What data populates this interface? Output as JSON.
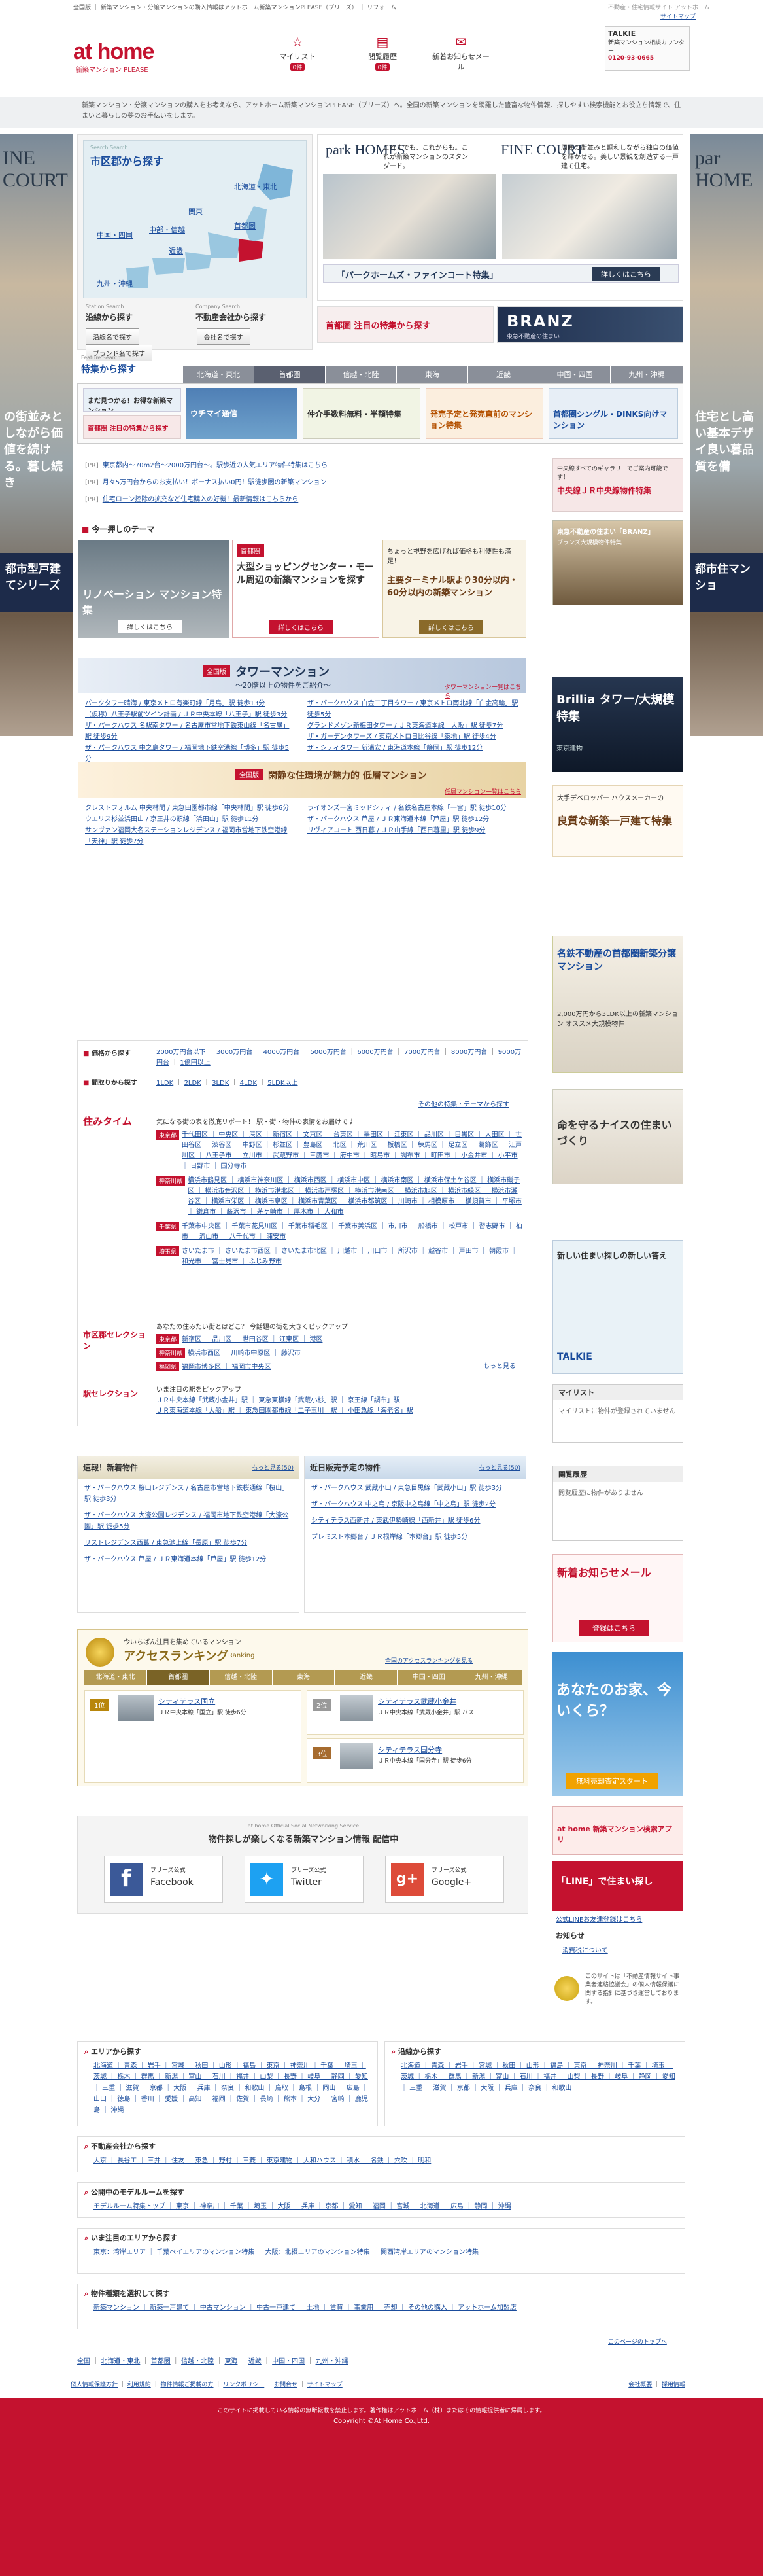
{
  "header": {
    "top_links": "全国版 ｜ 新築マンション・分譲マンションの購入情報はアットホーム新築マンションPLEASE（プリーズ） ｜ リフォーム",
    "right_links": "不動産・住宅情報サイト アットホーム",
    "site_map": "サイトマップ",
    "logo": "at home",
    "logo_sub": "新築マンション PLEASE",
    "mylist_label": "マイリスト",
    "mylist_count": "0件",
    "history_label": "閲覧履歴",
    "history_count": "0件",
    "mail_label": "新着お知らせメール",
    "talkie_title": "TALKIE",
    "talkie_text": "新築マンション相談カウンター",
    "talkie_phone": "0120-93-0665"
  },
  "intro": "新築マンション・分譲マンションの購入をお考えなら、アットホーム新築マンションPLEASE（プリーズ）へ。全国の新築マンションを網羅した豊富な物件情報、探しやすい検索機能とお役立ち情報で、住まいと暮らしの夢のお手伝いをします。",
  "side_left": {
    "title": "INE COURT",
    "text": "の街並みとしながら価値を続ける。暮し続き",
    "band": "都市型戸建てシリーズ"
  },
  "side_right": {
    "title": "par HOME",
    "text": "住宅とし高い基本デザイ良い暮品質を備",
    "band": "都市住マンショ"
  },
  "search": {
    "map_label": "Search Search",
    "map_title": "市区郡から探す",
    "regions": [
      "北海道・東北",
      "関東",
      "中部・信越",
      "近畿",
      "中国・四国",
      "九州・沖縄",
      "首都圏"
    ],
    "station_label": "Station Search",
    "station_title": "沿線から探す",
    "company_label": "Company Search",
    "company_title": "不動産会社から探す",
    "btn_station": "沿線名で探す",
    "btn_company": "会社名で探す",
    "btn_brand": "ブランド名で探す",
    "feature_label": "Feature Search",
    "feature_title": "特集から探す"
  },
  "promo_main": {
    "park_title": "park HOMES",
    "fine_title": "FINE COURT",
    "park_text": "これまでも、これからも。これが新築マンションのスタンダード。",
    "fine_text": "周囲の街並みと調和しながら独自の価値を輝かせる。美しい景観を創造する一戸建て住宅。",
    "banner": "「パークホームズ・ファインコート特集」",
    "banner_btn": "詳しくはこちら",
    "branz": "BRANZ",
    "branz_sub": "東急不動産の住まい",
    "fine_banner": "首都圏 注目の特集から探す"
  },
  "region_tabs": [
    "北海道・東北",
    "首都圏",
    "信越・北陸",
    "東海",
    "近畿",
    "中国・四国",
    "九州・沖縄"
  ],
  "feature_banners": [
    "まだ見つかる！お得な新築マンション",
    "首都圏 注目の特集から探す",
    "ウチマイ通信",
    "仲介手数料無料・半額特集",
    "駅近物件特集",
    "発売予定と発売直前のマンション特集",
    "首都圏シングル・DINKS向けマンション"
  ],
  "news": [
    "東京都内〜70m2台〜2000万円台〜。駅歩近の人気エリア物件特集はこちら",
    "月々5万円台からのお支払い！ボーナス払い0円！駅徒歩圏の新築マンション",
    "住宅ローン控除の拡充など住宅購入の好機！最新情報はこちらから"
  ],
  "right_ads": [
    {
      "title": "中央線ＪＲ中央線物件特集",
      "sub": "中央線すべてのギャラリーでご案内可能です！"
    },
    {
      "title": "東急不動産の住まい「BRANZ」",
      "sub": "ブランズ大規模物件特集"
    },
    {
      "title": "Brillia タワー/大規模特集",
      "sub": "東京建物"
    },
    {
      "title": "名鉄不動産の首都圏新築分譲マンション",
      "sub": "2,000万円から3LDK以上の新築マンション オススメ大規模物件"
    },
    {
      "title": "良質な新築一戸建て特集",
      "sub": "大手デベロッパー ハウスメーカーの"
    },
    {
      "title": "命を守るナイスの住まいづくり",
      "sub": ""
    },
    {
      "title": "新しい住まい探しの新しい答え",
      "sub": "TALKIE"
    }
  ],
  "mylist_box": {
    "title": "マイリスト",
    "text": "マイリストに物件が登録されていません"
  },
  "history_box": {
    "title": "閲覧履歴",
    "text": "閲覧履歴に物件がありません"
  },
  "right_bottom": {
    "mail_title": "新着お知らせメール",
    "mail_btn": "登録はこちら",
    "price_title": "あなたのお家、今いくら？",
    "price_btn": "無料売却査定スタート",
    "app_title": "at home 新築マンション検索アプリ",
    "line_title": "「LINE」で住まい探し",
    "line_link": "公式LINEお友達登録はこちら",
    "notice_title": "お知らせ",
    "notice_link": "消費税について",
    "privacy_text": "このサイトは「不動産情報サイト事業者連絡協議会」の個人情報保護に関する指針に基づき運営しております。"
  },
  "theme": {
    "heading": "今一押しのテーマ",
    "renovation": "リノベーション マンション特集",
    "renovation_btn": "詳しくはこちら",
    "shopping_tag": "首都圏",
    "shopping": "大型ショッピングセンター・モール周辺の新築マンションを探す",
    "shopping_btn": "詳しくはこちら",
    "terminal": "主要ターミナル駅より30分以内・60分以内の新築マンション",
    "terminal_note": "ちょっと視野を広げれば価格も利便性も満足！",
    "terminal_btn": "詳しくはこちら"
  },
  "tower": {
    "tag": "全国版",
    "title": "タワーマンション",
    "sub": "〜20階以上の物件をご紹介〜",
    "more": "タワーマンション一覧はこちら",
    "items": [
      "パークタワー晴海 / 東京メトロ有楽町線「月島」駅 徒歩13分",
      "ザ・パークハウス 白金二丁目タワー / 東京メトロ南北線「白金高輪」駅 徒歩5分",
      "（仮称）八王子駅前ツイン計画 / ＪＲ中央本線「八王子」駅 徒歩3分",
      "グランドメゾン新梅田タワー / ＪＲ東海道本線「大阪」駅 徒歩7分",
      "ザ・パークハウス 名駅南タワー / 名古屋市営地下鉄東山線「名古屋」駅 徒歩9分",
      "ザ・ガーデンタワーズ / 東京メトロ日比谷線「築地」駅 徒歩4分",
      "ザ・パークハウス 中之島タワー / 福岡地下鉄空港線「博多」駅 徒歩5分",
      "ザ・シティタワー 新浦安 / 東海道本線「静岡」駅 徒歩12分"
    ]
  },
  "lowrise": {
    "tag": "全国版",
    "title": "閑静な住環境が魅力的 低層マンション",
    "more": "低層マンション一覧はこちら",
    "items": [
      "クレストフォルム 中央林間 / 東急田園都市線「中央林間」駅 徒歩6分",
      "ライオンズ一宮ミッドシティ / 名鉄名古屋本線「一宮」駅 徒歩10分",
      "ウエリス杉並浜田山 / 京王井の頭線「浜田山」駅 徒歩11分",
      "ザ・パークハウス 芦屋 / ＪＲ東海道本線「芦屋」駅 徒歩12分",
      "サンヴァン福岡大名ステーションレジデンス / 福岡市営地下鉄空港線「天神」駅 徒歩7分",
      "リヴィアコート 西日暮 / ＪＲ山手線「西日暮里」駅 徒歩9分"
    ]
  },
  "price_search": {
    "label": "価格から探す",
    "tag": "首都圏",
    "items": [
      "2000万円台以下",
      "3000万円台",
      "4000万円台",
      "5000万円台",
      "6000万円台",
      "7000万円台",
      "8000万円台",
      "9000万円台",
      "1億円以上"
    ]
  },
  "layout_search": {
    "label": "間取りから探す",
    "items": [
      "1LDK",
      "2LDK",
      "3LDK",
      "4LDK",
      "5LDK以上"
    ],
    "more": "その他の特集・テーマから探す"
  },
  "sumi_time": {
    "logo": "住みタイム",
    "intro": "気になる街の表を徹底リポート！ 駅・街・物件の表情をお届けです",
    "rows": [
      {
        "area": "東京都",
        "text": "千代田区 ｜ 中央区 ｜ 港区 ｜ 新宿区 ｜ 文京区 ｜ 台東区 ｜ 墨田区 ｜ 江東区 ｜ 品川区 ｜ 目黒区 ｜ 大田区 ｜ 世田谷区 ｜ 渋谷区 ｜ 中野区 ｜ 杉並区 ｜ 豊島区 ｜ 北区 ｜ 荒川区 ｜ 板橋区 ｜ 練馬区 ｜ 足立区 ｜ 葛飾区 ｜ 江戸川区 ｜ 八王子市 ｜ 立川市 ｜ 武蔵野市 ｜ 三鷹市 ｜ 府中市 ｜ 昭島市 ｜ 調布市 ｜ 町田市 ｜ 小金井市 ｜ 小平市 ｜ 日野市 ｜ 国分寺市"
      },
      {
        "area": "神奈川県",
        "text": "横浜市鶴見区 ｜ 横浜市神奈川区 ｜ 横浜市西区 ｜ 横浜市中区 ｜ 横浜市南区 ｜ 横浜市保土ケ谷区 ｜ 横浜市磯子区 ｜ 横浜市金沢区 ｜ 横浜市港北区 ｜ 横浜市戸塚区 ｜ 横浜市港南区 ｜ 横浜市旭区 ｜ 横浜市緑区 ｜ 横浜市瀬谷区 ｜ 横浜市栄区 ｜ 横浜市泉区 ｜ 横浜市青葉区 ｜ 横浜市都筑区 ｜ 川崎市 ｜ 相模原市 ｜ 横須賀市 ｜ 平塚市 ｜ 鎌倉市 ｜ 藤沢市 ｜ 茅ヶ崎市 ｜ 厚木市 ｜ 大和市"
      },
      {
        "area": "千葉県",
        "text": "千葉市中央区 ｜ 千葉市花見川区 ｜ 千葉市稲毛区 ｜ 千葉市美浜区 ｜ 市川市 ｜ 船橋市 ｜ 松戸市 ｜ 習志野市 ｜ 柏市 ｜ 流山市 ｜ 八千代市 ｜ 浦安市"
      },
      {
        "area": "埼玉県",
        "text": "さいたま市 ｜ さいたま市西区 ｜ さいたま市北区 ｜ 川越市 ｜ 川口市 ｜ 所沢市 ｜ 越谷市 ｜ 戸田市 ｜ 朝霞市 ｜ 和光市 ｜ 富士見市 ｜ ふじみ野市"
      }
    ]
  },
  "shikugun": {
    "logo": "市区郡セレクション",
    "intro": "あなたの住みたい街とはどこ？ 今話題の街を大きくピックアップ",
    "rows": [
      {
        "area": "東京都",
        "text": "新宿区 ｜ 品川区 ｜ 世田谷区 ｜ 江東区 ｜ 港区"
      },
      {
        "area": "神奈川県",
        "text": "横浜市西区 ｜ 川崎市中原区 ｜ 藤沢市"
      },
      {
        "area": "福岡県",
        "text": "福岡市博多区 ｜ 福岡市中央区"
      }
    ],
    "more": "もっと見る"
  },
  "eki": {
    "logo": "駅セレクション",
    "intro": "いま注目の駅をピックアップ",
    "rows": [
      "ＪＲ中央本線「武蔵小金井」駅 ｜ 東急東横線「武蔵小杉」駅 ｜ 京王線「調布」駅",
      "ＪＲ東海道本線「大船」駅 ｜ 東急田園都市線「二子玉川」駅 ｜ 小田急線「海老名」駅"
    ]
  },
  "new_arrivals": {
    "title": "速報！新着物件",
    "more": "もっと見る(50)",
    "items": [
      "ザ・パークハウス 桜山レジデンス / 名古屋市営地下鉄桜通線「桜山」駅 徒歩3分",
      "ザ・パークハウス 大濠公園レジデンス / 福岡市地下鉄空港線「大濠公園」駅 徒歩5分",
      "リストレジデンス西葛 / 東急池上線「長原」駅 徒歩7分",
      "ザ・パークハウス 芦屋 / ＪＲ東海道本線「芦屋」駅 徒歩12分"
    ]
  },
  "upcoming": {
    "title": "近日販売予定の物件",
    "more": "もっと見る(50)",
    "items": [
      "ザ・パークハウス 武蔵小山 / 東急目黒線「武蔵小山」駅 徒歩3分",
      "ザ・パークハウス 中之島 / 京阪中之島線「中之島」駅 徒歩2分",
      "シティテラス西新井 / 東武伊勢崎線「西新井」駅 徒歩6分",
      "プレミスト本郷台 / ＪＲ根岸線「本郷台」駅 徒歩5分"
    ]
  },
  "ranking": {
    "intro": "今いちばん注目を集めているマンション",
    "title": "アクセスランキング",
    "sub": "Ranking",
    "tabs": [
      "北海道・東北",
      "首都圏",
      "信越・北陸",
      "東海",
      "近畿",
      "中国・四国",
      "九州・沖縄"
    ],
    "link": "全国のアクセスランキングを見る",
    "first": {
      "rank": "1位",
      "name": "シティテラス国立",
      "station": "ＪＲ中央本線「国立」駅 徒歩6分"
    },
    "second": {
      "rank": "2位",
      "name": "シティテラス武蔵小金井",
      "station": "ＪＲ中央本線「武蔵小金井」駅 バス"
    },
    "third": {
      "rank": "3位",
      "name": "シティテラス国分寺",
      "station": "ＪＲ中央本線「国分寺」駅 徒歩6分"
    }
  },
  "social": {
    "eng": "at home Official Social Networking Service",
    "title": "物件探しが楽しくなる新築マンション情報 配信中",
    "facebook": "Facebook",
    "twitter": "Twitter",
    "google": "Google+",
    "sub": "ブリーズ公式"
  },
  "footer_sections": [
    {
      "title": "エリアから探す",
      "body": "北海道 ｜ 青森 ｜ 岩手 ｜ 宮城 ｜ 秋田 ｜ 山形 ｜ 福島 ｜ 東京 ｜ 神奈川 ｜ 千葉 ｜ 埼玉 ｜ 茨城 ｜ 栃木 ｜ 群馬 ｜ 新潟 ｜ 富山 ｜ 石川 ｜ 福井 ｜ 山梨 ｜ 長野 ｜ 岐阜 ｜ 静岡 ｜ 愛知 ｜ 三重 ｜ 滋賀 ｜ 京都 ｜ 大阪 ｜ 兵庫 ｜ 奈良 ｜ 和歌山 ｜ 鳥取 ｜ 島根 ｜ 岡山 ｜ 広島 ｜ 山口 ｜ 徳島 ｜ 香川 ｜ 愛媛 ｜ 高知 ｜ 福岡 ｜ 佐賀 ｜ 長崎 ｜ 熊本 ｜ 大分 ｜ 宮崎 ｜ 鹿児島 ｜ 沖縄"
    },
    {
      "title": "沿線から探す",
      "body": "北海道 ｜ 青森 ｜ 岩手 ｜ 宮城 ｜ 秋田 ｜ 山形 ｜ 福島 ｜ 東京 ｜ 神奈川 ｜ 千葉 ｜ 埼玉 ｜ 茨城 ｜ 栃木 ｜ 群馬 ｜ 新潟 ｜ 富山 ｜ 石川 ｜ 福井 ｜ 山梨 ｜ 長野 ｜ 岐阜 ｜ 静岡 ｜ 愛知 ｜ 三重 ｜ 滋賀 ｜ 京都 ｜ 大阪 ｜ 兵庫 ｜ 奈良 ｜ 和歌山"
    },
    {
      "title": "不動産会社から探す",
      "body": "大京 ｜ 長谷工 ｜ 三井 ｜ 住友 ｜ 東急 ｜ 野村 ｜ 三菱 ｜ 東京建物 ｜ 大和ハウス ｜ 積水 ｜ 名鉄 ｜ 穴吹 ｜ 明和"
    },
    {
      "title": "公開中のモデルルームを探す",
      "body": "モデルルーム特集トップ ｜ 東京 ｜ 神奈川 ｜ 千葉 ｜ 埼玉 ｜ 大阪 ｜ 兵庫 ｜ 京都 ｜ 愛知 ｜ 福岡 ｜ 宮城 ｜ 北海道 ｜ 広島 ｜ 静岡 ｜ 沖縄"
    },
    {
      "title": "いま注目のエリアから探す",
      "body": "東京：湾岸エリア ｜ 千葉ベイエリアのマンション特集 ｜ 大阪：北摂エリアのマンション特集 ｜ 関西湾岸エリアのマンション特集"
    },
    {
      "title": "物件種類を選択して探す",
      "body": "新築マンション ｜ 新築一戸建て ｜ 中古マンション ｜ 中古一戸建て ｜ 土地 ｜ 賃貸 ｜ 事業用 ｜ 売却 ｜ その他の購入 ｜ アットホーム加盟店"
    }
  ],
  "page_top": "このページのトップへ",
  "region_footer": [
    "全国",
    "北海道・東北",
    "首都圏",
    "信越・北陸",
    "東海",
    "近畿",
    "中国・四国",
    "九州・沖縄"
  ],
  "bottom_links": [
    "個人情報保護方針",
    "利用規約",
    "物件情報ご掲載の方",
    "リンクポリシー",
    "お問合せ",
    "サイトマップ"
  ],
  "bottom_right": [
    "会社概要",
    "採用情報"
  ],
  "copyright_note": "このサイトに掲載している情報の無断転載を禁止します。著作権はアットホーム（株）またはその情報提供者に帰属します。",
  "copyright": "Copyright ©At Home Co.,Ltd."
}
